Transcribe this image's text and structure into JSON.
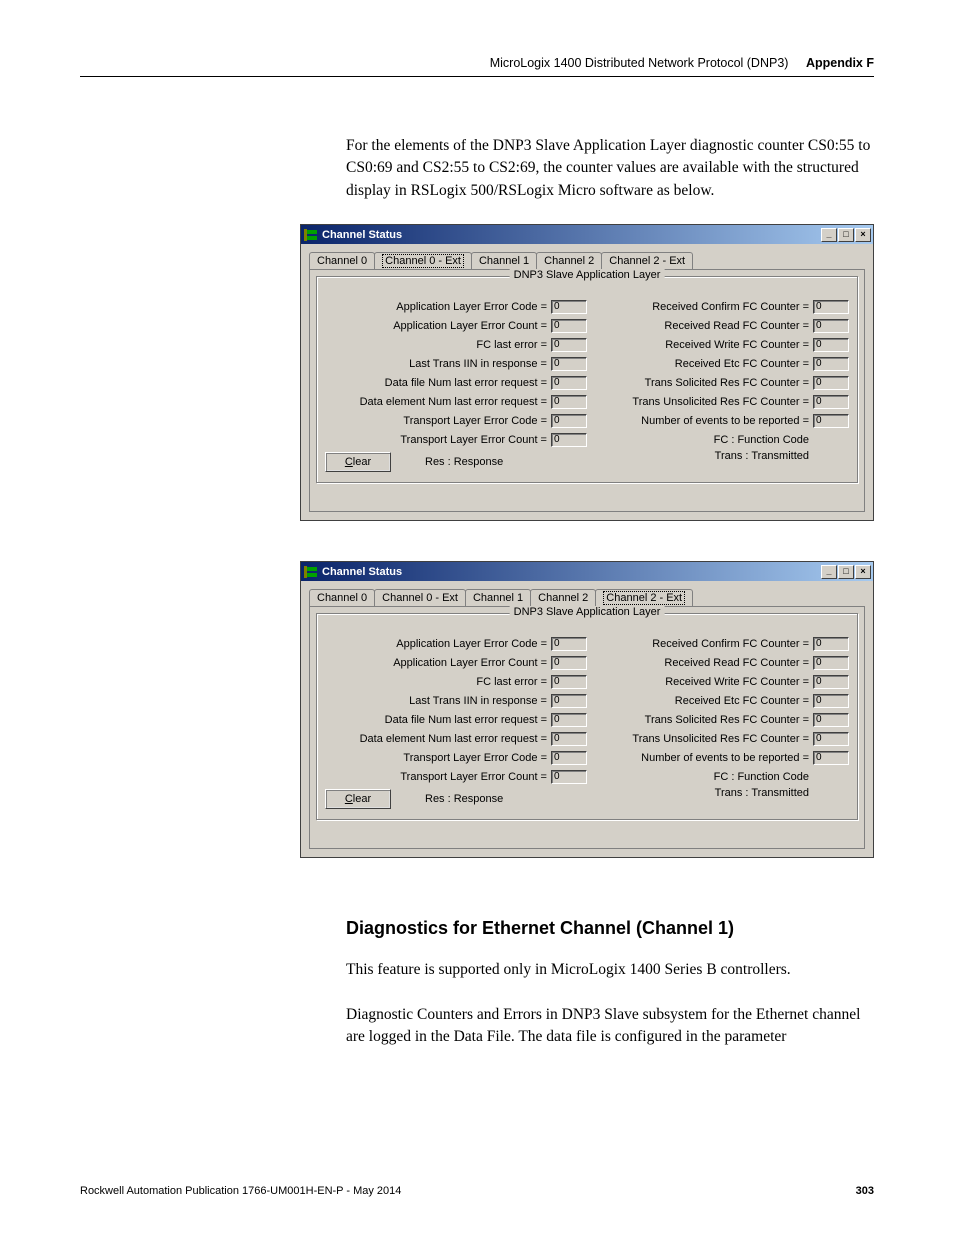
{
  "header": {
    "doc_title": "MicroLogix 1400 Distributed Network Protocol (DNP3)",
    "appendix": "Appendix F"
  },
  "intro_para": "For the elements of the DNP3 Slave Application Layer diagnostic counter CS0:55 to CS0:69 and CS2:55 to CS2:69, the counter values are available with the structured display in RSLogix 500/RSLogix Micro software as below.",
  "dialog": {
    "title": "Channel Status",
    "tabs": [
      "Channel 0",
      "Channel 0 - Ext",
      "Channel 1",
      "Channel 2",
      "Channel 2 - Ext"
    ],
    "group_title": "DNP3 Slave Application Layer",
    "left_fields": [
      {
        "label": "Application Layer Error Code =",
        "value": "0"
      },
      {
        "label": "Application Layer Error Count =",
        "value": "0"
      },
      {
        "label": "FC last error =",
        "value": "0"
      },
      {
        "label": "Last Trans IIN in response =",
        "value": "0"
      },
      {
        "label": "Data file Num last error request =",
        "value": "0"
      },
      {
        "label": "Data element Num last error request =",
        "value": "0"
      },
      {
        "label": "Transport Layer Error Code =",
        "value": "0"
      },
      {
        "label": "Transport Layer Error Count =",
        "value": "0"
      }
    ],
    "right_fields": [
      {
        "label": "Received Confirm FC Counter =",
        "value": "0"
      },
      {
        "label": "Received Read FC Counter =",
        "value": "0"
      },
      {
        "label": "Received Write FC Counter =",
        "value": "0"
      },
      {
        "label": "Received Etc FC Counter =",
        "value": "0"
      },
      {
        "label": "Trans Solicited Res FC Counter =",
        "value": "0"
      },
      {
        "label": "Trans Unsolicited Res FC Counter =",
        "value": "0"
      },
      {
        "label": "Number of events to be reported =",
        "value": "0"
      }
    ],
    "legend_right1": "FC : Function Code",
    "legend_right2": "Trans : Transmitted",
    "legend_left": "Res : Response",
    "clear_label": "Clear",
    "active_tab_1": 1,
    "active_tab_2": 4
  },
  "section_heading": "Diagnostics for Ethernet Channel (Channel 1)",
  "para2": "This feature is supported only in MicroLogix 1400 Series B controllers.",
  "para3": "Diagnostic Counters and Errors in DNP3 Slave subsystem for the Ethernet channel are logged in the Data File. The data file is configured in the parameter",
  "footer": {
    "pub": "Rockwell Automation Publication 1766-UM001H-EN-P - May 2014",
    "page": "303"
  }
}
